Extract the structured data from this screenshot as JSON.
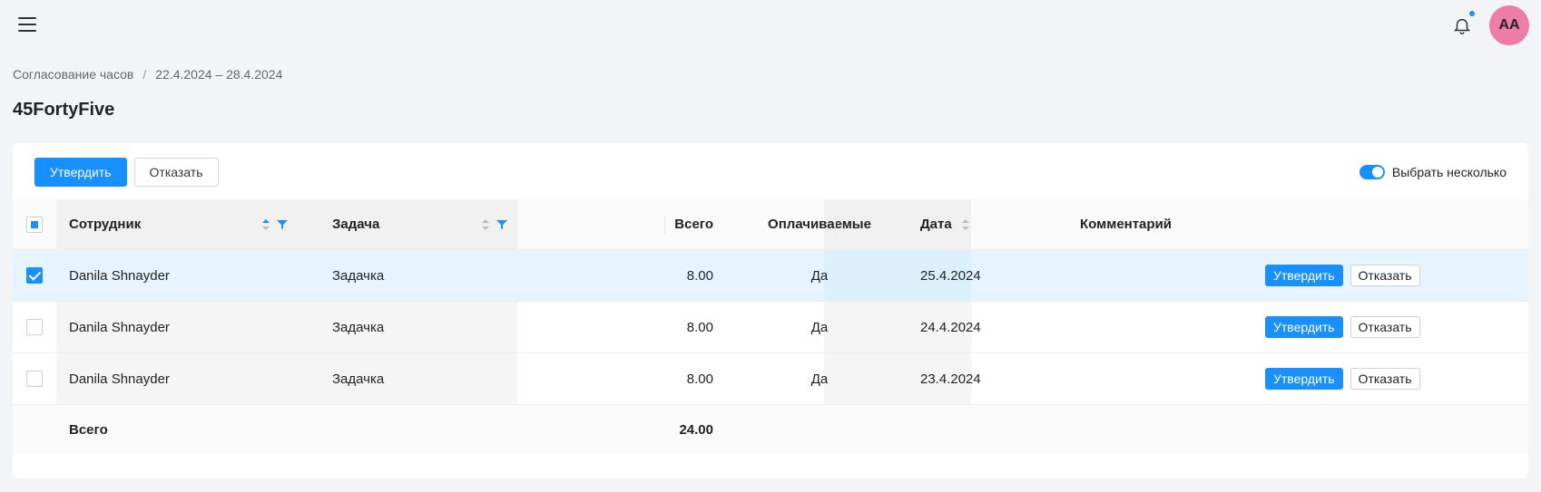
{
  "header": {
    "avatar_initials": "AA",
    "notification_dot_color": "#1890ff"
  },
  "breadcrumb": {
    "section": "Согласование часов",
    "separator": "/",
    "range": "22.4.2024 – 28.4.2024"
  },
  "page_title": "45FortyFive",
  "toolbar": {
    "approve_label": "Утвердить",
    "reject_label": "Отказать",
    "multi_select_label": "Выбрать несколько",
    "multi_select_on": true
  },
  "table": {
    "columns": {
      "employee": "Сотрудник",
      "task": "Задача",
      "total": "Всего",
      "billable": "Оплачиваемые",
      "date": "Дата",
      "comment": "Комментарий"
    },
    "rows": [
      {
        "employee": "Danila Shnayder",
        "task": "Задачка",
        "total": "8.00",
        "billable": "Да",
        "date": "25.4.2024",
        "comment": "",
        "selected": true,
        "approve": "Утвердить",
        "reject": "Отказать"
      },
      {
        "employee": "Danila Shnayder",
        "task": "Задачка",
        "total": "8.00",
        "billable": "Да",
        "date": "24.4.2024",
        "comment": "",
        "selected": false,
        "approve": "Утвердить",
        "reject": "Отказать"
      },
      {
        "employee": "Danila Shnayder",
        "task": "Задачка",
        "total": "8.00",
        "billable": "Да",
        "date": "23.4.2024",
        "comment": "",
        "selected": false,
        "approve": "Утвердить",
        "reject": "Отказать"
      }
    ],
    "footer": {
      "label": "Всего",
      "total": "24.00"
    }
  },
  "colors": {
    "accent": "#1890ff",
    "avatar": "#ee7da6",
    "selected_row": "#e6f4ff"
  }
}
